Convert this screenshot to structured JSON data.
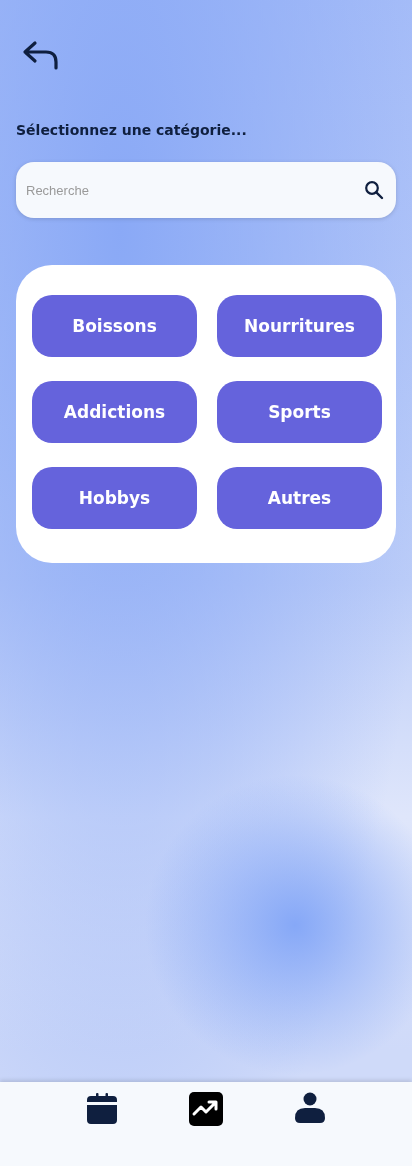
{
  "title": "Sélectionnez une catégorie...",
  "search": {
    "placeholder": "Recherche"
  },
  "categories": [
    {
      "label": "Boissons"
    },
    {
      "label": "Nourritures"
    },
    {
      "label": "Addictions"
    },
    {
      "label": "Sports"
    },
    {
      "label": "Hobbys"
    },
    {
      "label": "Autres"
    }
  ],
  "nav": [
    {
      "kind": "calendar",
      "selected": false
    },
    {
      "kind": "trend",
      "selected": true
    },
    {
      "kind": "profile",
      "selected": false
    }
  ]
}
